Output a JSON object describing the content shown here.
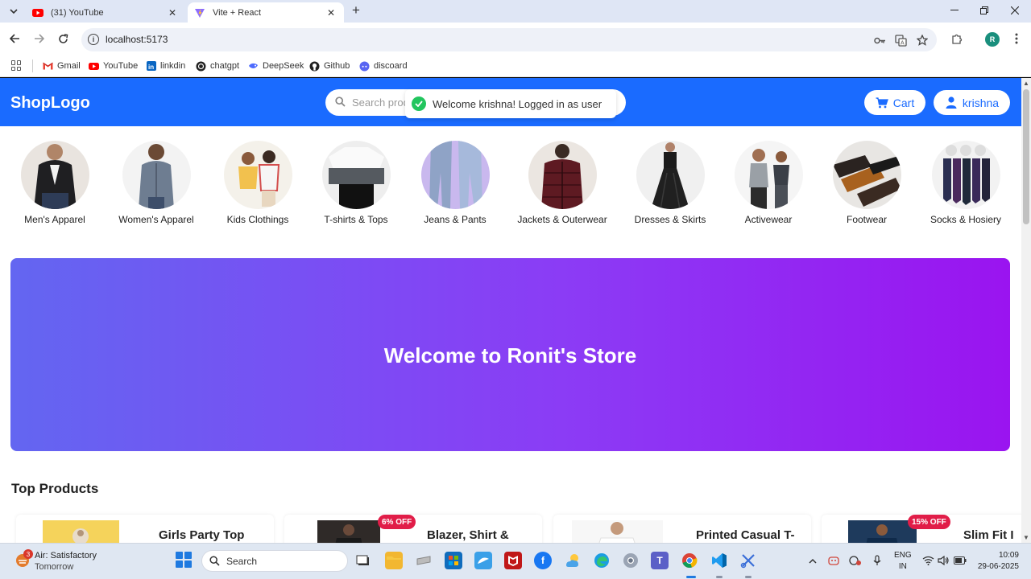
{
  "browser": {
    "tabs": [
      {
        "title": "(31) YouTube",
        "active": false
      },
      {
        "title": "Vite + React",
        "active": true
      }
    ],
    "url": "localhost:5173",
    "profile_initial": "R",
    "bookmarks": [
      {
        "label": "Gmail",
        "icon": "gmail-icon"
      },
      {
        "label": "YouTube",
        "icon": "youtube-icon"
      },
      {
        "label": "linkdin",
        "icon": "linkedin-icon"
      },
      {
        "label": "chatgpt",
        "icon": "chatgpt-icon"
      },
      {
        "label": "DeepSeek",
        "icon": "deepseek-icon"
      },
      {
        "label": "Github",
        "icon": "github-icon"
      },
      {
        "label": "discoard",
        "icon": "discord-icon"
      }
    ]
  },
  "site": {
    "logo": "ShopLogo",
    "search_placeholder": "Search products...",
    "toast": "Welcome krishna! Logged in as user",
    "cart_label": "Cart",
    "user_label": "krishna",
    "accent": "#1a6bff",
    "categories": [
      {
        "label": "Men's Apparel"
      },
      {
        "label": "Women's Apparel"
      },
      {
        "label": "Kids Clothings"
      },
      {
        "label": "T-shirts & Tops"
      },
      {
        "label": "Jeans & Pants"
      },
      {
        "label": "Jackets & Outerwear"
      },
      {
        "label": "Dresses & Skirts"
      },
      {
        "label": "Activewear"
      },
      {
        "label": "Footwear"
      },
      {
        "label": "Socks & Hosiery"
      }
    ],
    "hero_title": "Welcome to Ronit's Store",
    "section_title": "Top Products",
    "products": [
      {
        "name": "Girls Party Top",
        "badge": ""
      },
      {
        "name": "Blazer, Shirt &",
        "badge": "6% OFF"
      },
      {
        "name": "Printed Casual T-",
        "badge": ""
      },
      {
        "name": "Slim Fit I",
        "badge": "15% OFF"
      }
    ]
  },
  "taskbar": {
    "weather_line1": "Air: Satisfactory",
    "weather_line2": "Tomorrow",
    "weather_badge": "3",
    "search_label": "Search",
    "lang_line1": "ENG",
    "lang_line2": "IN",
    "time": "10:09",
    "date": "29-06-2025"
  }
}
